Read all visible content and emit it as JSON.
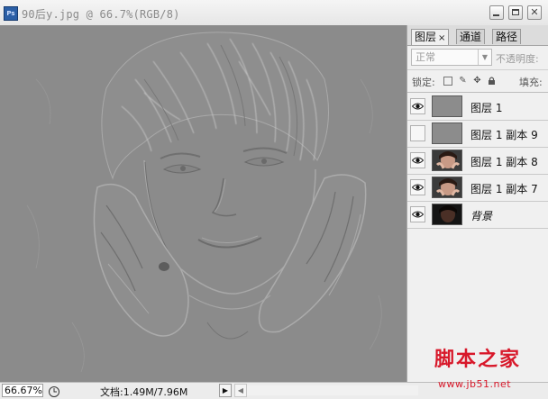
{
  "window": {
    "title": "90后y.jpg @ 66.7%(RGB/8)",
    "app_icon_text": "Ps"
  },
  "panel": {
    "tabs": [
      {
        "label": "图层",
        "active": true,
        "close": "×"
      },
      {
        "label": "通道",
        "active": false
      },
      {
        "label": "路径",
        "active": false
      }
    ],
    "blend_mode": "正常",
    "opacity_label": "不透明度:",
    "lock_label": "锁定:",
    "fill_label": "填充:",
    "layers": [
      {
        "name": "图层 1",
        "visible": true,
        "thumb": "gray"
      },
      {
        "name": "图层 1 副本 9",
        "visible": false,
        "thumb": "gray"
      },
      {
        "name": "图层 1 副本 8",
        "visible": true,
        "thumb": "photo"
      },
      {
        "name": "图层 1 副本 7",
        "visible": true,
        "thumb": "photo"
      },
      {
        "name": "背景",
        "visible": true,
        "thumb": "dark"
      }
    ]
  },
  "status": {
    "zoom": "66.67%",
    "doc_info": "文档:1.49M/7.96M",
    "arrow": "▶",
    "scroll_left": "◀"
  },
  "watermark": {
    "main": "脚本之家",
    "sub": "www.jb51.net"
  },
  "colors": {
    "canvas_gray": "#8c8c8c",
    "panel_bg": "#f0f0f0",
    "watermark_red": "#d8182a"
  }
}
